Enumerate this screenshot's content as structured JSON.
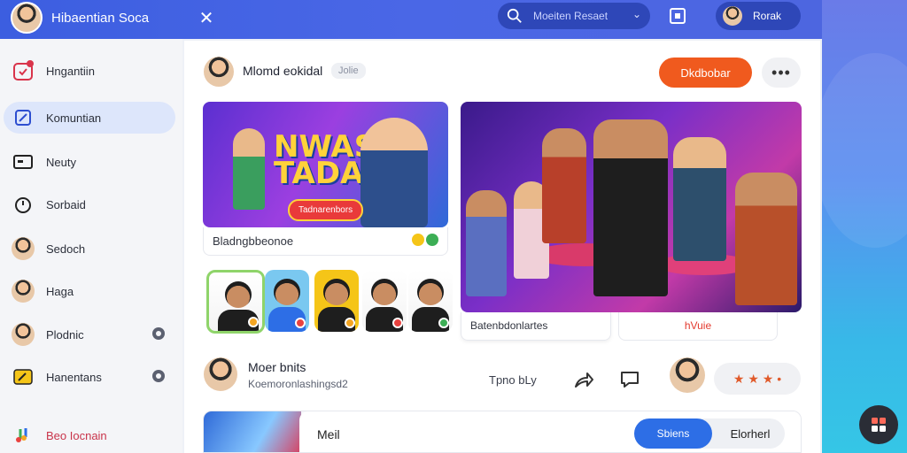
{
  "app": {
    "title": "Hibaentian Soca",
    "close_glyph": "✕"
  },
  "search": {
    "placeholder": "Moeiten Resaet"
  },
  "user": {
    "name": "Rorak"
  },
  "sidebar": {
    "items": [
      {
        "label": "Hngantiin",
        "icon": "calendar-alert-icon"
      },
      {
        "label": "Komuntian",
        "icon": "edit-square-icon",
        "active": true
      },
      {
        "label": "Neuty",
        "icon": "video-card-icon"
      },
      {
        "label": "Sorbaid",
        "icon": "timer-icon"
      },
      {
        "label": "Sedoch",
        "icon": "avatar"
      },
      {
        "label": "Haga",
        "icon": "avatar"
      },
      {
        "label": "Plodnic",
        "icon": "avatar"
      },
      {
        "label": "Hanentans",
        "icon": "note-icon"
      },
      {
        "label": "Beo Iocnain",
        "icon": "music-icon"
      }
    ]
  },
  "post": {
    "author": "Mlomd eokidal",
    "chip": "Jolie",
    "follow_label": "Dkdbobar",
    "more_label": "•••",
    "card1": {
      "headline": "NWAS TADARS",
      "cta": "Tadnarenbors",
      "caption": "Bladngbbeonoe"
    },
    "card2": {
      "caption": "Batenbdonlartes",
      "side_label": "hVuie"
    }
  },
  "activity": {
    "title": "Moer bnits",
    "subtitle": "Koemoronlashingsd2",
    "time": "Tpno bLy",
    "rating": "★ ★ ★ •"
  },
  "bottom": {
    "label": "Meil",
    "seg_on": "Sbiens",
    "seg_off": "Elorherl"
  },
  "colors": {
    "accent": "#3c5ee0",
    "follow": "#f05a1e",
    "segment": "#2d6ee6"
  }
}
